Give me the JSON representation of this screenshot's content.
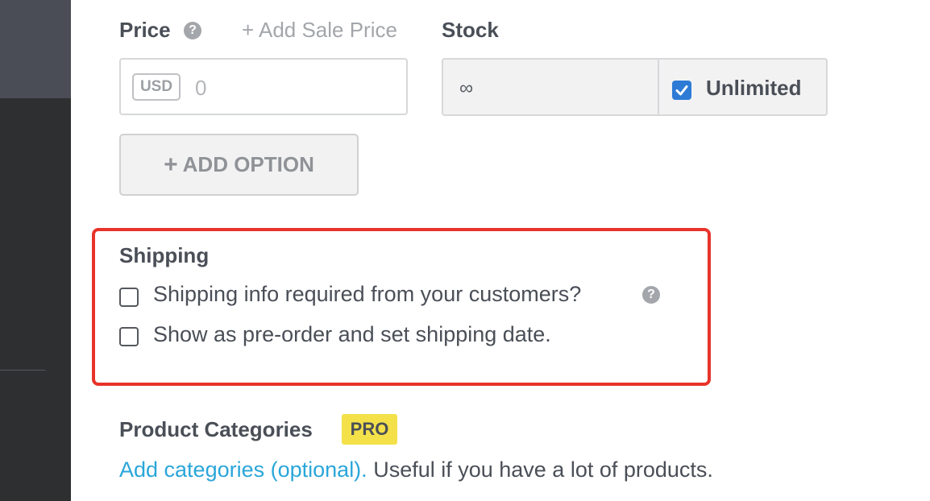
{
  "price": {
    "label": "Price",
    "add_sale_link": "+ Add Sale Price",
    "currency": "USD",
    "placeholder": "0"
  },
  "stock": {
    "label": "Stock",
    "value": "∞",
    "unlimited_label": "Unlimited",
    "unlimited_checked": true
  },
  "add_option": {
    "plus": "+",
    "label": "ADD OPTION"
  },
  "shipping": {
    "heading": "Shipping",
    "options": [
      {
        "label": "Shipping info required from your customers?",
        "checked": false
      },
      {
        "label": "Show as pre-order and set shipping date.",
        "checked": false
      }
    ]
  },
  "categories": {
    "heading": "Product Categories",
    "badge": "PRO",
    "link": "Add categories (optional).",
    "description": " Useful if you have a lot of products."
  },
  "icons": {
    "help": "?"
  },
  "colors": {
    "highlight_border": "#e8332b",
    "checkbox_checked": "#2e7bd6",
    "link": "#2aa6d9",
    "pro_badge": "#f4e14a"
  }
}
